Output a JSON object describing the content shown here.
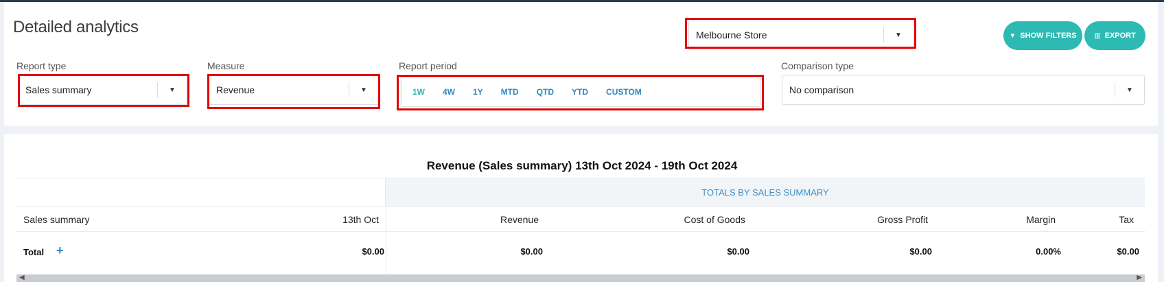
{
  "page": {
    "title": "Detailed analytics"
  },
  "store_select": {
    "value": "Melbourne Store"
  },
  "buttons": {
    "show_filters": "SHOW FILTERS",
    "export": "EXPORT"
  },
  "filters": {
    "report_type": {
      "label": "Report type",
      "value": "Sales summary"
    },
    "measure": {
      "label": "Measure",
      "value": "Revenue"
    },
    "report_period": {
      "label": "Report period",
      "options": [
        "1W",
        "4W",
        "1Y",
        "MTD",
        "QTD",
        "YTD",
        "CUSTOM"
      ],
      "active": "1W"
    },
    "comparison_type": {
      "label": "Comparison type",
      "value": "No comparison"
    }
  },
  "report": {
    "title": "Revenue (Sales summary) 13th Oct 2024 - 19th Oct 2024",
    "group_header": "TOTALS BY SALES SUMMARY",
    "columns": {
      "sales_summary": "Sales summary",
      "date": "13th Oct",
      "revenue": "Revenue",
      "cost_of_goods": "Cost of Goods",
      "gross_profit": "Gross Profit",
      "margin": "Margin",
      "tax": "Tax"
    },
    "total_row": {
      "label": "Total",
      "date": "$0.00",
      "revenue": "$0.00",
      "cost_of_goods": "$0.00",
      "gross_profit": "$0.00",
      "margin": "0.00%",
      "tax": "$0.00"
    }
  },
  "colors": {
    "accent": "#2dbab3",
    "link": "#2f86c2",
    "highlight": "#e40000"
  }
}
